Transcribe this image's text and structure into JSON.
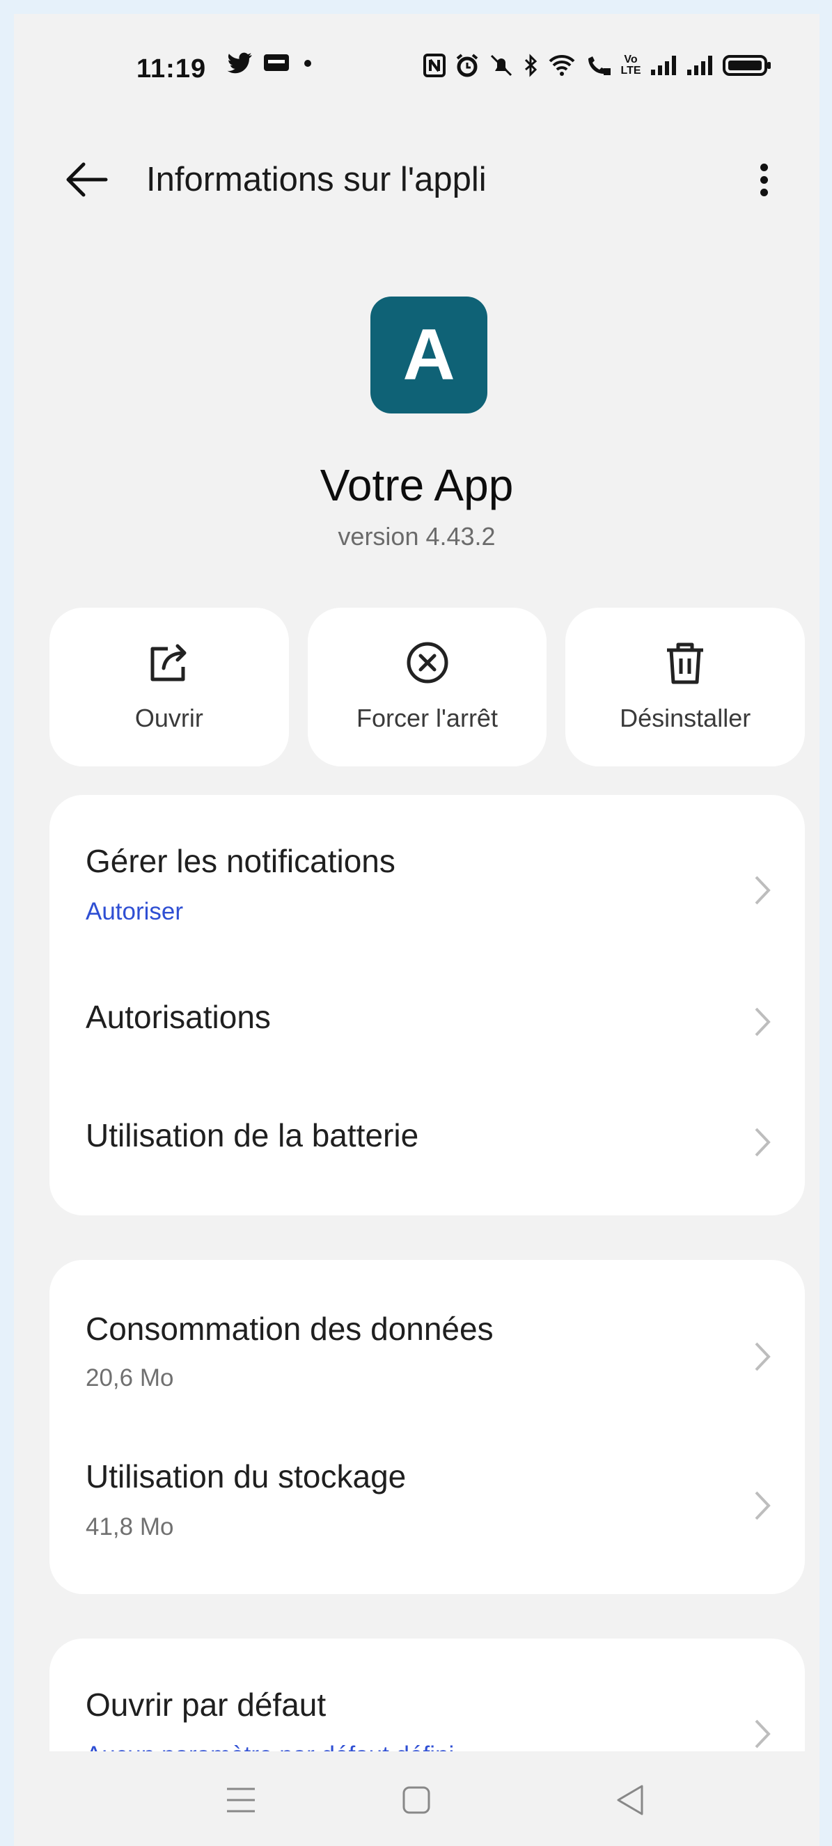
{
  "status_bar": {
    "time": "11:19",
    "left_icons": [
      "twitter-icon",
      "bfm-icon",
      "dot-icon"
    ],
    "right_icons": [
      "nfc-icon",
      "alarm-icon",
      "mute-icon",
      "bluetooth-icon",
      "wifi-icon",
      "wifi-call-icon",
      "volte-icon",
      "signal-icon",
      "signal-icon",
      "battery-icon"
    ],
    "volte_label": "Vo LTE"
  },
  "app_bar": {
    "title": "Informations sur l'appli"
  },
  "app": {
    "icon_letter": "A",
    "icon_color": "#0f6276",
    "name": "Votre App",
    "version": "version 4.43.2"
  },
  "actions": [
    {
      "label": "Ouvrir",
      "icon": "open-external-icon"
    },
    {
      "label": "Forcer l'arrêt",
      "icon": "force-stop-icon"
    },
    {
      "label": "Désinstaller",
      "icon": "trash-icon"
    }
  ],
  "card1": {
    "items": [
      {
        "title": "Gérer les notifications",
        "subtitle": "Autoriser"
      },
      {
        "title": "Autorisations"
      },
      {
        "title": "Utilisation de la batterie"
      }
    ]
  },
  "card2": {
    "items": [
      {
        "title": "Consommation des données",
        "subtitle": "20,6 Mo"
      },
      {
        "title": "Utilisation du stockage",
        "subtitle": "41,8 Mo"
      }
    ]
  },
  "card3": {
    "items": [
      {
        "title": "Ouvrir par défaut",
        "subtitle": "Aucun paramètre par défaut défini"
      }
    ]
  },
  "nav_bar": {
    "buttons": [
      "menu-icon",
      "home-icon",
      "back-triangle-icon"
    ]
  },
  "colors": {
    "accent_blue": "#2f4fd3",
    "background": "#f2f2f2",
    "outer_background": "#e6f1fa"
  }
}
